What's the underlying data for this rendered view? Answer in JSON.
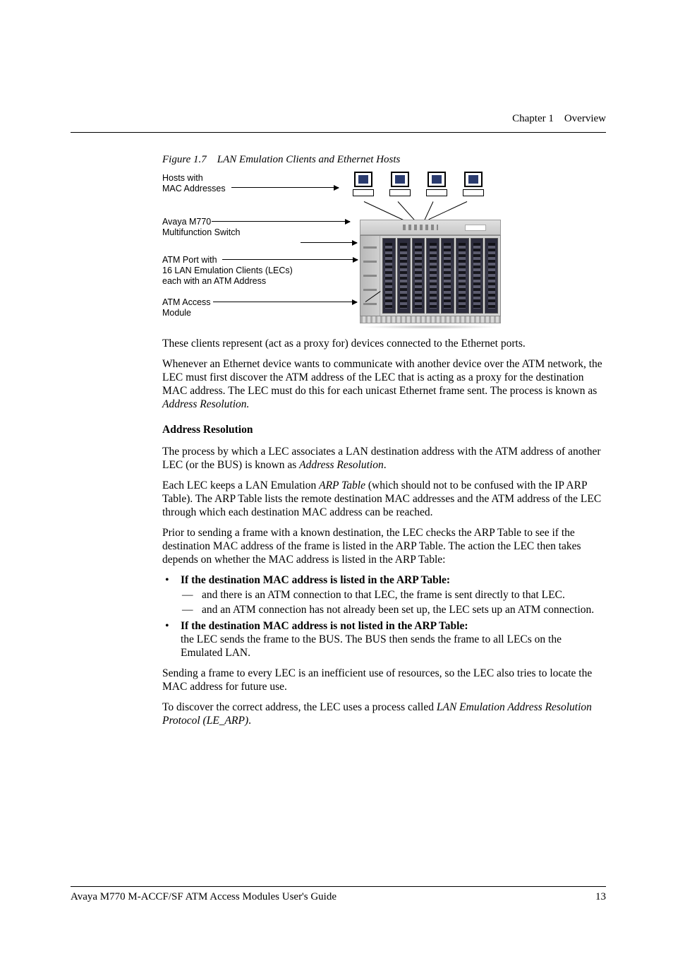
{
  "header": {
    "chapter": "Chapter 1",
    "title": "Overview"
  },
  "figure": {
    "caption_prefix": "Figure 1.7",
    "caption_title": "LAN Emulation Clients and Ethernet Hosts",
    "labels": {
      "hosts_l1": "Hosts with",
      "hosts_l2": "MAC Addresses",
      "switch_l1": "Avaya M770",
      "switch_l2": "Multifunction Switch",
      "port_l1": "ATM Port with",
      "port_l2": "16 LAN Emulation Clients (LECs)",
      "port_l3": "each with an ATM Address",
      "access_l1": "ATM Access",
      "access_l2": "Module"
    }
  },
  "para1": "These clients represent (act as a proxy for) devices connected to the Ethernet ports.",
  "para2a": "Whenever an Ethernet device wants to communicate with another device over the ATM network, the LEC must first discover the ATM address of the LEC that is acting as a proxy for the destination MAC address. The LEC must do this for each unicast Ethernet frame sent. The process is known as ",
  "para2b": "Address Resolution.",
  "heading1": "Address Resolution",
  "para3a": "The process by which a LEC associates a LAN destination address with the ATM address of another LEC (or the BUS) is known as ",
  "para3b": "Address Resolution",
  "para3c": ".",
  "para4a": "Each LEC keeps a LAN Emulation ",
  "para4b": "ARP Table",
  "para4c": " (which should not to be confused with the IP ARP Table). The ARP Table lists the remote destination MAC addresses and the ATM address of the LEC through which each destination MAC address can be reached.",
  "para5": "Prior to sending a frame with a known destination, the LEC checks the ARP Table to see if the destination MAC address of the frame is listed in the ARP Table. The action the LEC then takes depends on whether the MAC address is listed in the ARP Table:",
  "bullet1_head": "If the destination MAC address is listed in the ARP Table:",
  "bullet1_sub1": "and there is an ATM connection to that LEC, the frame is sent directly to that LEC.",
  "bullet1_sub2": "and an ATM connection has not already been set up, the LEC sets up an ATM connection.",
  "bullet2_head": "If the destination MAC address is not listed in the ARP Table:",
  "bullet2_body": "the LEC sends the frame to the BUS. The BUS then sends the frame to all LECs on the Emulated LAN.",
  "para6": "Sending a frame to every LEC is an inefficient use of resources, so the LEC also tries to locate the MAC address for future use.",
  "para7a": "To discover the correct address, the LEC uses a process called ",
  "para7b": "LAN Emulation Address Resolution Protocol (LE_ARP)",
  "para7c": ".",
  "footer": {
    "left": "Avaya M770 M-ACCF/SF ATM Access Modules User's Guide",
    "right": "13"
  }
}
